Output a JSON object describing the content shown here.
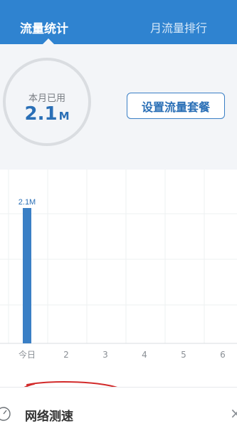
{
  "tabs": [
    {
      "label": "流量统计",
      "active": true
    },
    {
      "label": "月流量排行",
      "active": false
    }
  ],
  "summary": {
    "used_label": "本月已用",
    "used_value": "2.1",
    "used_unit": "M",
    "plan_button_label": "设置流量套餐"
  },
  "chart_data": {
    "type": "bar",
    "categories": [
      "今日",
      "2",
      "3",
      "4",
      "5",
      "6"
    ],
    "values": [
      2.1,
      0,
      0,
      0,
      0,
      0
    ],
    "data_labels": [
      "2.1M",
      "",
      "",
      "",
      "",
      ""
    ],
    "ylim": [
      0,
      2.1
    ],
    "grid": true,
    "bar_color": "#3a7fc5"
  },
  "speed_test": {
    "label": "网络测速",
    "icon": "speedometer-icon",
    "close_icon": "close-icon"
  },
  "colors": {
    "header": "#2f83d0",
    "accent": "#2a6fb6",
    "annotation": "#d22a2a"
  }
}
